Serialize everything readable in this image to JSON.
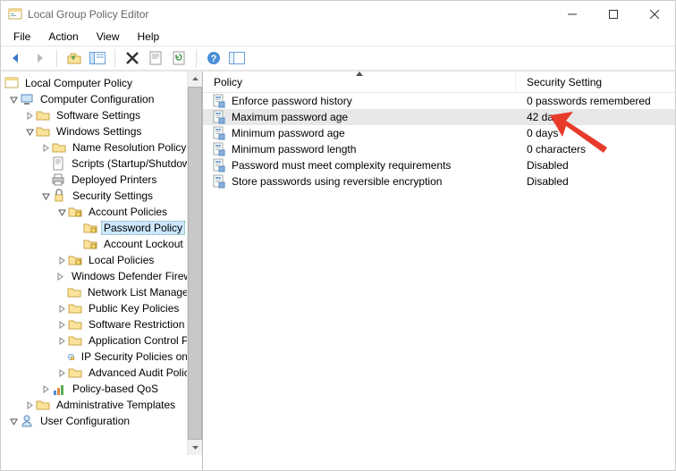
{
  "title": "Local Group Policy Editor",
  "menus": {
    "file": "File",
    "action": "Action",
    "view": "View",
    "help": "Help"
  },
  "tree": {
    "root": "Local Computer Policy",
    "computer_config": "Computer Configuration",
    "software_settings": "Software Settings",
    "windows_settings": "Windows Settings",
    "name_resolution": "Name Resolution Policy",
    "scripts": "Scripts (Startup/Shutdown)",
    "deployed_printers": "Deployed Printers",
    "security_settings": "Security Settings",
    "account_policies": "Account Policies",
    "password_policy": "Password Policy",
    "account_lockout": "Account Lockout Policy",
    "local_policies": "Local Policies",
    "windows_defender": "Windows Defender Firewall with Advanced Security",
    "network_list": "Network List Manager Policies",
    "public_key": "Public Key Policies",
    "software_restriction": "Software Restriction Policies",
    "application_control": "Application Control Policies",
    "ip_security": "IP Security Policies on Local Computer",
    "advanced_audit": "Advanced Audit Policy Configuration",
    "policy_qos": "Policy-based QoS",
    "admin_templates": "Administrative Templates",
    "user_config": "User Configuration"
  },
  "list": {
    "headers": {
      "policy": "Policy",
      "setting": "Security Setting"
    },
    "rows": [
      {
        "policy": "Enforce password history",
        "setting": "0 passwords remembered"
      },
      {
        "policy": "Maximum password age",
        "setting": "42 days",
        "selected": true
      },
      {
        "policy": "Minimum password age",
        "setting": "0 days"
      },
      {
        "policy": "Minimum password length",
        "setting": "0 characters"
      },
      {
        "policy": "Password must meet complexity requirements",
        "setting": "Disabled"
      },
      {
        "policy": "Store passwords using reversible encryption",
        "setting": "Disabled"
      }
    ]
  }
}
